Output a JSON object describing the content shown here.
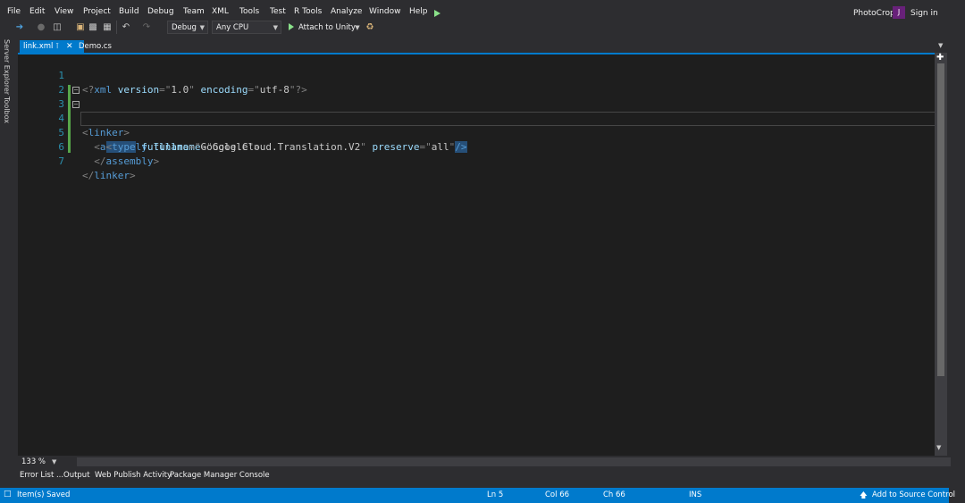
{
  "menu": {
    "items": [
      "File",
      "Edit",
      "View",
      "Project",
      "Build",
      "Debug",
      "Team",
      "XML",
      "Tools",
      "Test",
      "R Tools",
      "Analyze",
      "Window",
      "Help"
    ]
  },
  "title_bar": {
    "app_title": "PhotoCrop",
    "account_initial": "J",
    "sign_in": "Sign in"
  },
  "toolbar": {
    "configuration": "Debug",
    "platform": "Any CPU",
    "attach_label": "Attach to Unity"
  },
  "side_strip": {
    "server_explorer": "Server Explorer",
    "toolbox": "Toolbox"
  },
  "tabs": [
    {
      "label": "link.xml",
      "active": true
    },
    {
      "label": "Demo.cs",
      "active": false
    }
  ],
  "editor": {
    "lines": [
      {
        "n": "1",
        "text": "<?xml version=\"1.0\" encoding=\"utf-8\"?>"
      },
      {
        "n": "2",
        "text": ""
      },
      {
        "n": "3",
        "text": "<linker>"
      },
      {
        "n": "4",
        "text": "  <assembly fullname=\"Google\">"
      },
      {
        "n": "5",
        "text": "    <type fullname=\"Google.Cloud.Translation.V2\" preserve=\"all\"/>"
      },
      {
        "n": "6",
        "text": "  </assembly>"
      },
      {
        "n": "7",
        "text": "</linker>"
      }
    ],
    "zoom": "133 %"
  },
  "tool_windows": [
    "Error List ...",
    "Output",
    "Web Publish Activity",
    "Package Manager Console"
  ],
  "status": {
    "message": "Item(s) Saved",
    "ln": "Ln 5",
    "col": "Col 66",
    "ch": "Ch 66",
    "mode": "INS",
    "source_control": "Add to Source Control"
  },
  "colors": {
    "accent": "#007acc",
    "background": "#2d2d30",
    "editor_bg": "#1e1e1e",
    "change_marker": "#57a64a"
  }
}
